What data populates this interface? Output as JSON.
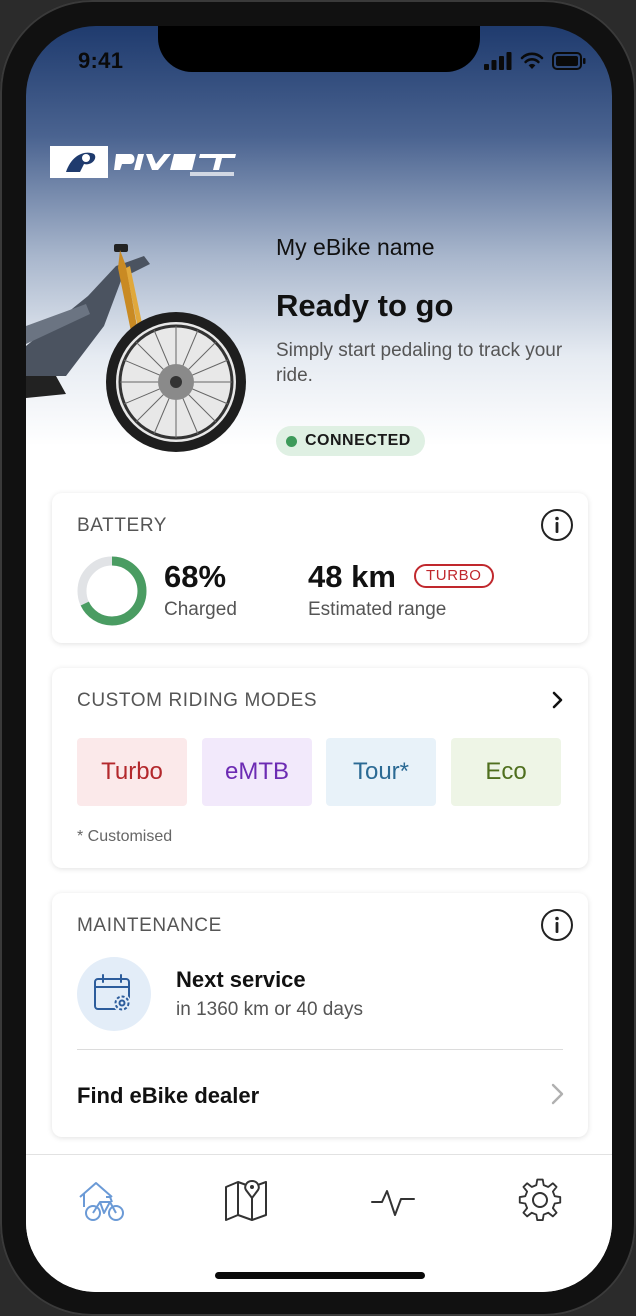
{
  "status_bar": {
    "time": "9:41"
  },
  "brand": {
    "name": "PIVOT",
    "tagline": "CYCLES"
  },
  "hero": {
    "bike_name": "My eBike name",
    "status": "Ready to go",
    "subtitle": "Simply start pedaling to track your ride.",
    "connection": "CONNECTED"
  },
  "battery": {
    "title": "BATTERY",
    "percent_value": 68,
    "percent_text": "68%",
    "percent_label": "Charged",
    "range_text": "48 km",
    "range_mode_badge": "TURBO",
    "range_label": "Estimated range"
  },
  "modes": {
    "title": "CUSTOM RIDING MODES",
    "items": [
      {
        "label": "Turbo",
        "color": "#b3282c",
        "bg": "#fbe9ea"
      },
      {
        "label": "eMTB",
        "color": "#6c2bb3",
        "bg": "#f2e9fb"
      },
      {
        "label": "Tour*",
        "color": "#2b6a94",
        "bg": "#e8f2f9"
      },
      {
        "label": "Eco",
        "color": "#4f6f1e",
        "bg": "#eef5e6"
      }
    ],
    "note": "* Customised"
  },
  "maintenance": {
    "title": "MAINTENANCE",
    "next_service_title": "Next service",
    "next_service_detail": "in 1360 km or 40 days",
    "dealer_link": "Find eBike dealer"
  },
  "colors": {
    "accent_green": "#3d9a5a",
    "turbo_red": "#c0282d",
    "active_tab": "#6b9ad6"
  }
}
